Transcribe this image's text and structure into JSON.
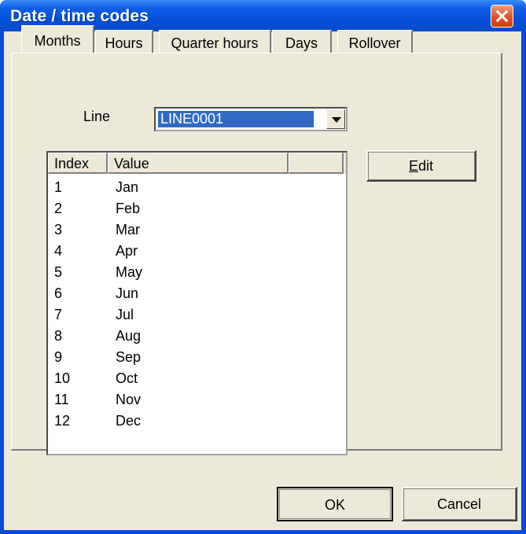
{
  "window": {
    "title": "Date / time codes"
  },
  "tabs": [
    {
      "label": "Months",
      "active": true
    },
    {
      "label": "Hours",
      "active": false
    },
    {
      "label": "Quarter hours",
      "active": false
    },
    {
      "label": "Days",
      "active": false
    },
    {
      "label": "Rollover",
      "active": false
    }
  ],
  "line": {
    "label": "Line",
    "selected_value": "LINE0001"
  },
  "list": {
    "columns": [
      "Index",
      "Value",
      ""
    ],
    "rows": [
      {
        "index": "1",
        "value": "Jan"
      },
      {
        "index": "2",
        "value": "Feb"
      },
      {
        "index": "3",
        "value": "Mar"
      },
      {
        "index": "4",
        "value": "Apr"
      },
      {
        "index": "5",
        "value": "May"
      },
      {
        "index": "6",
        "value": "Jun"
      },
      {
        "index": "7",
        "value": "Jul"
      },
      {
        "index": "8",
        "value": "Aug"
      },
      {
        "index": "9",
        "value": "Sep"
      },
      {
        "index": "10",
        "value": "Oct"
      },
      {
        "index": "11",
        "value": "Nov"
      },
      {
        "index": "12",
        "value": "Dec"
      }
    ]
  },
  "buttons": {
    "edit_mnemonic": "E",
    "edit_rest": "dit",
    "ok": "OK",
    "cancel": "Cancel"
  },
  "colors": {
    "titlebar": "#0550d9",
    "face": "#ece9d8",
    "selection": "#316ac5",
    "close": "#e1512b"
  }
}
